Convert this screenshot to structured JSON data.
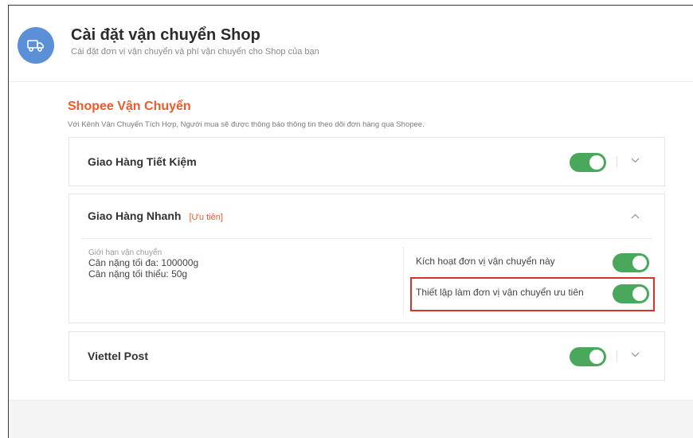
{
  "header": {
    "title": "Cài đặt vận chuyển Shop",
    "subtitle": "Cài đặt đơn vị vận chuyển và phí vận chuyển cho Shop của bạn",
    "icon": "truck-icon"
  },
  "section": {
    "title": "Shopee Vận Chuyển",
    "description": "Với Kênh Vận Chuyển Tích Hợp, Người mua sẽ được thông báo thông tin theo dõi đơn hàng qua Shopee."
  },
  "carriers": [
    {
      "name": "Giao Hàng Tiết Kiệm",
      "enabled": true,
      "expanded": false
    },
    {
      "name": "Giao Hàng Nhanh",
      "tag": "[Ưu tiên]",
      "expanded": true,
      "limits": {
        "label": "Giới hạn vận chuyển",
        "max_weight": "Cân nặng tối đa: 100000g",
        "min_weight": "Cân nặng tối thiểu: 50g"
      },
      "options": [
        {
          "label": "Kích hoạt đơn vị vận chuyển này",
          "enabled": true
        },
        {
          "label": "Thiết lập làm đơn vị vận chuyển ưu tiên",
          "enabled": true
        }
      ]
    },
    {
      "name": "Viettel Post",
      "enabled": true,
      "expanded": false
    }
  ],
  "colors": {
    "accent": "#ee5a2a",
    "toggle_on": "#4aa85d",
    "header_icon_bg": "#5b8fd6",
    "highlight": "#d9342b"
  }
}
